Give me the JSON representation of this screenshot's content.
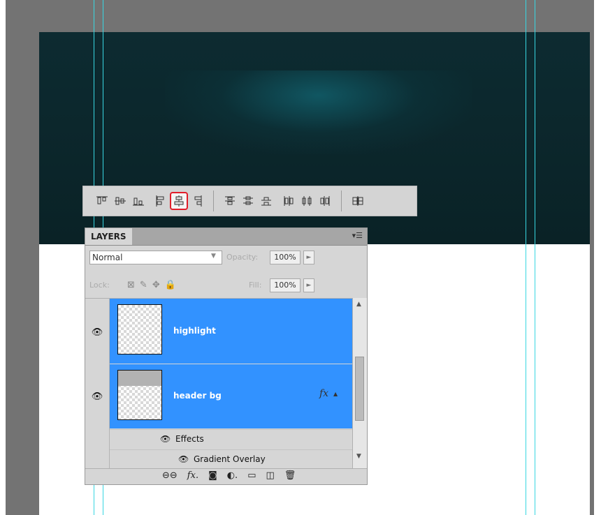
{
  "align_toolbar": {
    "groups": [
      [
        "align-top-edges-icon",
        "align-vertical-centers-icon",
        "align-bottom-edges-icon",
        "align-left-edges-icon",
        "align-horizontal-centers-icon",
        "align-right-edges-icon"
      ],
      [
        "distribute-top-edges-icon",
        "distribute-vertical-centers-icon",
        "distribute-bottom-edges-icon",
        "distribute-left-edges-icon",
        "distribute-horizontal-centers-icon",
        "distribute-right-edges-icon"
      ],
      [
        "auto-align-layers-icon"
      ]
    ],
    "selected": "align-horizontal-centers-icon"
  },
  "layers_panel": {
    "tab_label": "LAYERS",
    "menu_icon": "panel-menu-icon",
    "blend_mode": "Normal",
    "opacity_label": "Opacity:",
    "opacity_value": "100%",
    "lock_label": "Lock:",
    "fill_label": "Fill:",
    "fill_value": "100%",
    "layers": [
      {
        "name": "highlight",
        "visible": true,
        "selected": true
      },
      {
        "name": "header bg",
        "visible": true,
        "selected": true,
        "fx": "fx"
      }
    ],
    "effects_label": "Effects",
    "effect_items": [
      "Gradient Overlay"
    ],
    "footer_icons": [
      "link-layers-icon",
      "layer-style-icon",
      "add-mask-icon",
      "adjustment-layer-icon",
      "new-group-icon",
      "new-layer-icon",
      "delete-layer-icon"
    ]
  },
  "colors": {
    "header_dark": "#0b2529",
    "glow": "#126673",
    "selection_blue": "#3292ff",
    "guide": "#38d7e2",
    "frame_gray": "#737373"
  }
}
